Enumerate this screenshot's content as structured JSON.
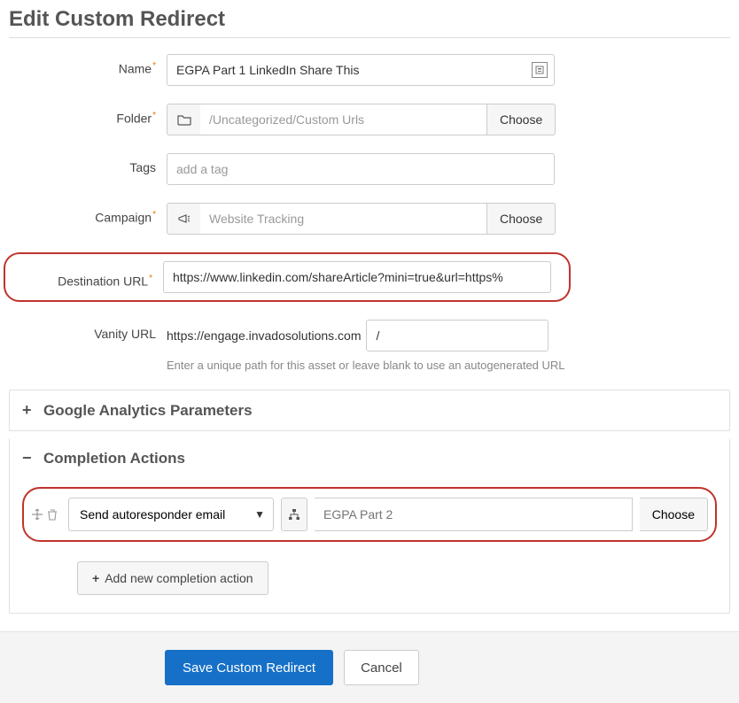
{
  "page_title": "Edit Custom Redirect",
  "labels": {
    "name": "Name",
    "folder": "Folder",
    "tags": "Tags",
    "campaign": "Campaign",
    "destination": "Destination URL",
    "vanity": "Vanity URL"
  },
  "name_value": "EGPA Part 1 LinkedIn Share This",
  "folder": {
    "placeholder": "/Uncategorized/Custom Urls",
    "choose": "Choose"
  },
  "tags_placeholder": "add a tag",
  "campaign": {
    "placeholder": "Website Tracking",
    "choose": "Choose"
  },
  "destination_value": "https://www.linkedin.com/shareArticle?mini=true&url=https%",
  "vanity": {
    "prefix": "https://engage.invadosolutions.com",
    "value": "/",
    "hint": "Enter a unique path for this asset or leave blank to use an autogenerated URL"
  },
  "sections": {
    "ga": "Google Analytics Parameters",
    "completion": "Completion Actions"
  },
  "completion": {
    "action_select": "Send autoresponder email",
    "target_placeholder": "EGPA Part 2",
    "choose": "Choose",
    "add_new": "Add new completion action"
  },
  "footer": {
    "save": "Save Custom Redirect",
    "cancel": "Cancel"
  }
}
